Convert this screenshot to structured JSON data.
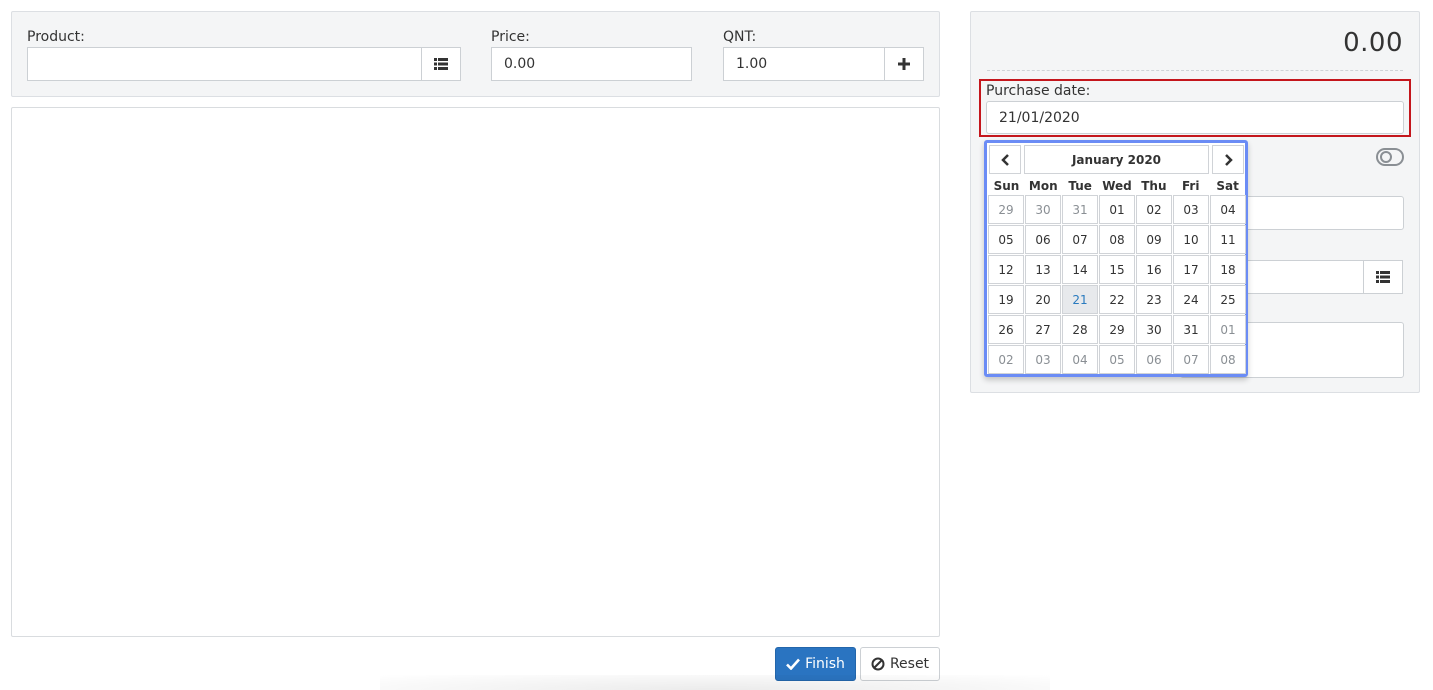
{
  "product_form": {
    "product_label": "Product:",
    "product_value": "",
    "price_label": "Price:",
    "price_value": "0.00",
    "qnt_label": "QNT:",
    "qnt_value": "1.00"
  },
  "summary": {
    "total": "0.00",
    "purchase_date_label": "Purchase date:",
    "purchase_date_value": "21/01/2020"
  },
  "calendar": {
    "title": "January 2020",
    "weekdays": [
      "Sun",
      "Mon",
      "Tue",
      "Wed",
      "Thu",
      "Fri",
      "Sat"
    ],
    "weeks": [
      [
        "29",
        "30",
        "31",
        "01",
        "02",
        "03",
        "04"
      ],
      [
        "05",
        "06",
        "07",
        "08",
        "09",
        "10",
        "11"
      ],
      [
        "12",
        "13",
        "14",
        "15",
        "16",
        "17",
        "18"
      ],
      [
        "19",
        "20",
        "21",
        "22",
        "23",
        "24",
        "25"
      ],
      [
        "26",
        "27",
        "28",
        "29",
        "30",
        "31",
        "01"
      ],
      [
        "02",
        "03",
        "04",
        "05",
        "06",
        "07",
        "08"
      ]
    ],
    "selected_day": "21"
  },
  "actions": {
    "finish_label": "Finish",
    "reset_label": "Reset"
  },
  "colors": {
    "primary": "#2a74c1",
    "highlight_border": "#c4161c",
    "calendar_border": "#6b8cf5"
  }
}
